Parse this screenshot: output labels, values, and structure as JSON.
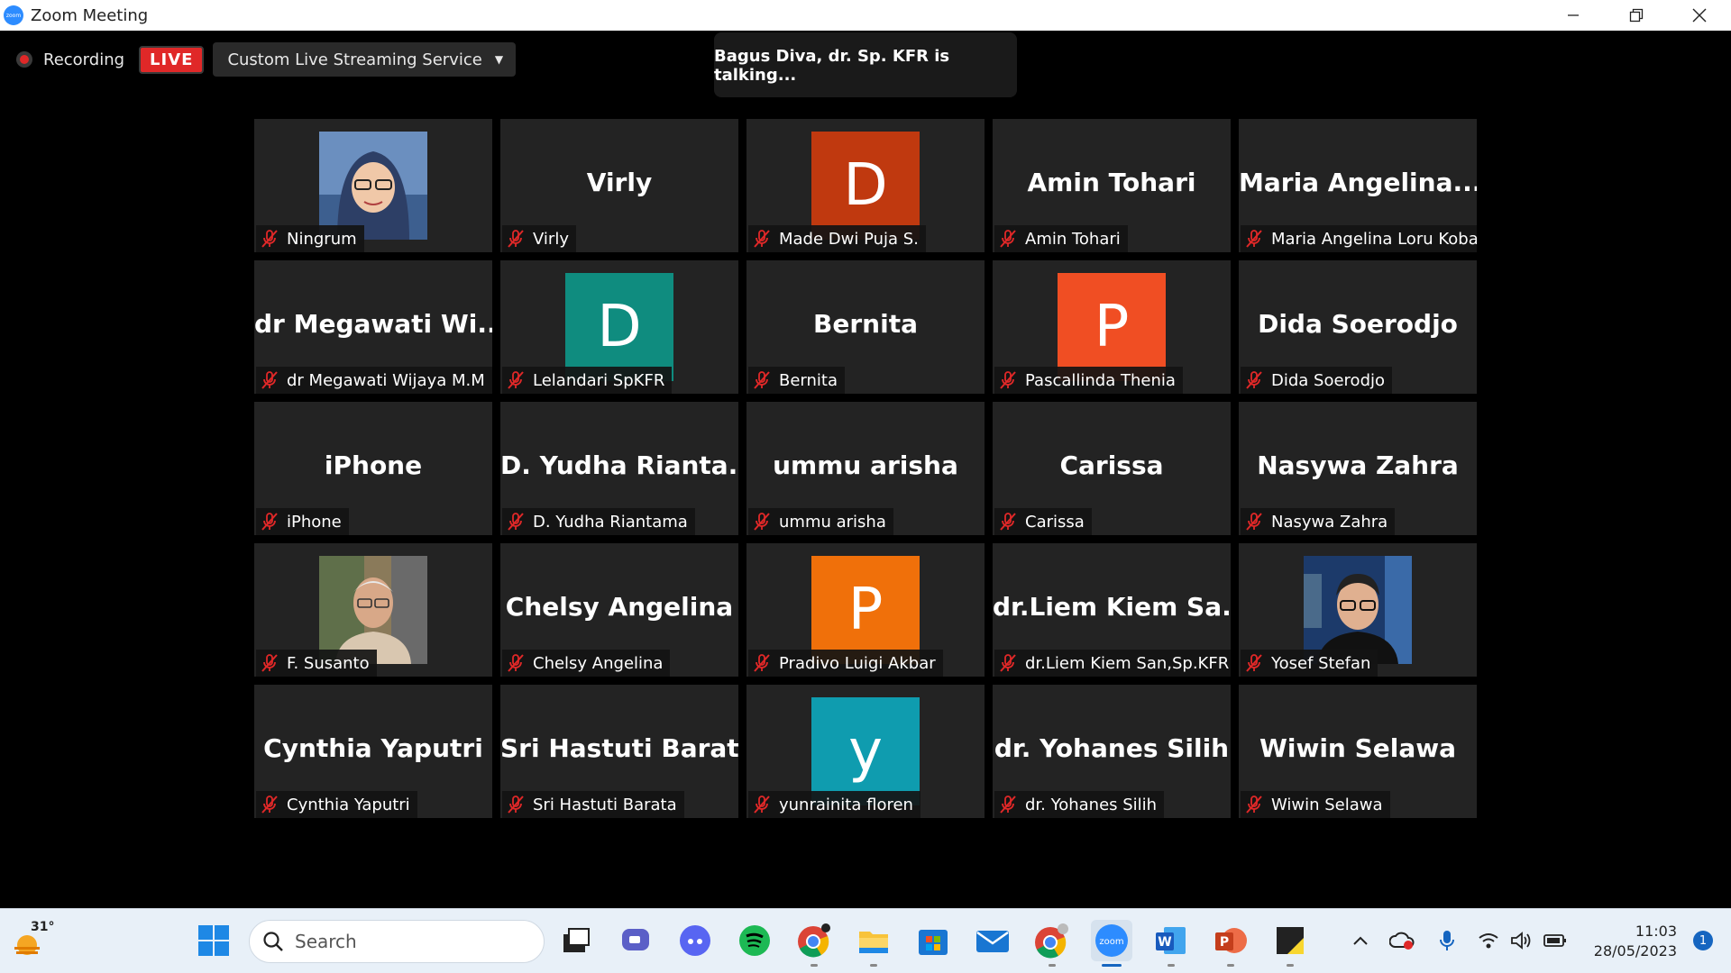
{
  "window": {
    "title": "Zoom Meeting"
  },
  "meeting": {
    "recording_label": "Recording",
    "live_badge": "LIVE",
    "stream_service": "Custom Live Streaming Service",
    "talking_banner": "Bagus Diva, dr. Sp. KFR is talking...",
    "participants": [
      {
        "name": "Ningrum",
        "tile": "photo",
        "photo": "woman-hijab"
      },
      {
        "name": "Virly",
        "tile": "text",
        "display": "Virly"
      },
      {
        "name": "Made Dwi Puja S.",
        "tile": "avatar",
        "letter": "D",
        "color": "#c0390f"
      },
      {
        "name": "Amin Tohari",
        "tile": "text",
        "display": "Amin Tohari"
      },
      {
        "name": "Maria Angelina Loru Koba",
        "tile": "text",
        "display": "Maria  Angelina..."
      },
      {
        "name": "dr Megawati Wijaya M.M",
        "tile": "text",
        "display": "dr  Megawati  Wi..."
      },
      {
        "name": "Lelandari SpKFR",
        "tile": "avatar",
        "letter": "D",
        "color": "#0f8c7f"
      },
      {
        "name": "Bernita",
        "tile": "text",
        "display": "Bernita"
      },
      {
        "name": "Pascallinda Thenia",
        "tile": "avatar",
        "letter": "P",
        "color": "#f04e23"
      },
      {
        "name": "Dida Soerodjo",
        "tile": "text",
        "display": "Dida Soerodjo"
      },
      {
        "name": "iPhone",
        "tile": "text",
        "display": "iPhone"
      },
      {
        "name": "D. Yudha Riantama",
        "tile": "text",
        "display": "D.  Yudha  Rianta..."
      },
      {
        "name": "ummu arisha",
        "tile": "text",
        "display": "ummu arisha"
      },
      {
        "name": "Carissa",
        "tile": "text",
        "display": "Carissa"
      },
      {
        "name": "Nasywa Zahra",
        "tile": "text",
        "display": "Nasywa Zahra"
      },
      {
        "name": "F. Susanto",
        "tile": "photo",
        "photo": "older-man"
      },
      {
        "name": "Chelsy Angelina",
        "tile": "text",
        "display": "Chelsy Angelina"
      },
      {
        "name": "Pradivo Luigi Akbar",
        "tile": "avatar",
        "letter": "P",
        "color": "#f0700a"
      },
      {
        "name": "dr.Liem Kiem San,Sp.KFR",
        "tile": "text",
        "display": "dr.Liem  Kiem  Sa..."
      },
      {
        "name": "Yosef Stefan",
        "tile": "photo",
        "photo": "young-man-glasses"
      },
      {
        "name": "Cynthia Yaputri",
        "tile": "text",
        "display": "Cynthia Yaputri"
      },
      {
        "name": "Sri Hastuti Barata",
        "tile": "text",
        "display": "Sri Hastuti Barata"
      },
      {
        "name": "yunrainita floren",
        "tile": "avatar",
        "letter": "y",
        "color": "#0f9caf"
      },
      {
        "name": "dr. Yohanes Silih",
        "tile": "text",
        "display": "dr. Yohanes Silih"
      },
      {
        "name": "Wiwin Selawa",
        "tile": "text",
        "display": "Wiwin Selawa"
      }
    ],
    "mute_icon": "microphone-muted-icon"
  },
  "taskbar": {
    "weather_temp": "31°",
    "search_placeholder": "Search",
    "apps": [
      "start",
      "task-view",
      "teams-chat",
      "discord",
      "spotify",
      "chrome",
      "file-explorer",
      "microsoft-store",
      "mail",
      "chrome-profile",
      "zoom",
      "word",
      "powerpoint",
      "sticky-notes"
    ],
    "clock_time": "11:03",
    "clock_date": "28/05/2023",
    "notification_count": "1"
  },
  "colors": {
    "accent": "#2d8cff",
    "live_red": "#e02828",
    "tile_bg": "#232323"
  }
}
